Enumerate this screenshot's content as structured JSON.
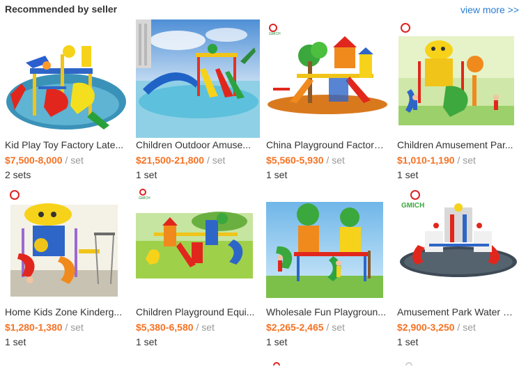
{
  "section": {
    "title": "Recommended by seller",
    "view_more": "view more >>"
  },
  "colors": {
    "price": "#f57224",
    "link": "#2a7dd2",
    "text": "#333333",
    "muted": "#999999"
  },
  "products": [
    {
      "title": "Kid Play Toy Factory Late...",
      "price": "$7,500-8,000",
      "unit": "/ set",
      "moq": "2 sets",
      "image": "water-park-slide-image",
      "badge": ""
    },
    {
      "title": "Children Outdoor Amuse...",
      "price": "$21,500-21,800",
      "unit": "/ set",
      "moq": "1 set",
      "image": "water-slide-pool-image",
      "badge": ""
    },
    {
      "title": "China Playground Factory...",
      "price": "$5,560-5,930",
      "unit": "/ set",
      "moq": "1 set",
      "image": "tree-playground-image",
      "badge": "GMICH"
    },
    {
      "title": "Children Amusement Par...",
      "price": "$1,010-1,190",
      "unit": "/ set",
      "moq": "1 set",
      "image": "fruit-playground-image",
      "badge": ""
    },
    {
      "title": "Home Kids Zone Kinderg...",
      "price": "$1,280-1,380",
      "unit": "/ set",
      "moq": "1 set",
      "image": "mushroom-playground-image",
      "badge": ""
    },
    {
      "title": "Children Playground Equi...",
      "price": "$5,380-6,580",
      "unit": "/ set",
      "moq": "1 set",
      "image": "outdoor-playground-image",
      "badge": "GMICH"
    },
    {
      "title": "Wholesale Fun Playgroun...",
      "price": "$2,265-2,465",
      "unit": "/ set",
      "moq": "1 set",
      "image": "treehouse-playground-image",
      "badge": ""
    },
    {
      "title": "Amusement Park Water S...",
      "price": "$2,900-3,250",
      "unit": "/ set",
      "moq": "1 set",
      "image": "water-play-structure-image",
      "badge": "GMICH"
    }
  ]
}
